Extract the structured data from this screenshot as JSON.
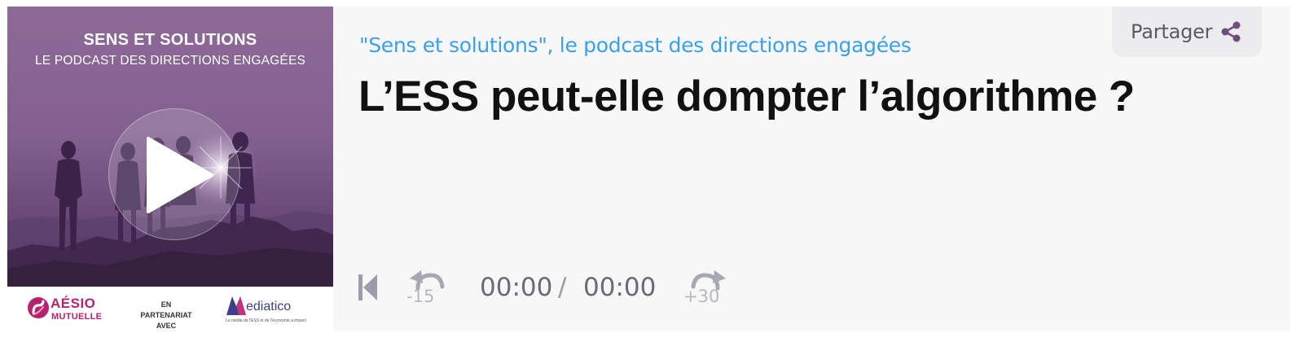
{
  "cover": {
    "title": "SENS ET SOLUTIONS",
    "subtitle": "LE PODCAST DES DIRECTIONS ENGAGÉES",
    "background_color": "#83608f",
    "footer": {
      "left_logo": {
        "name": "AÉSIO",
        "sub": "MUTUELLE",
        "color": "#b5236f"
      },
      "partner_text_line1": "EN PARTENARIAT",
      "partner_text_line2": "AVEC",
      "right_logo": {
        "name": "ediatico",
        "tagline": "Le média de l'ESS et de l'économie à impact",
        "color": "#3a3f8f"
      }
    }
  },
  "header": {
    "podcast_name": "\"Sens et solutions\", le podcast des directions engagées",
    "link_color": "#3aa0e8"
  },
  "episode": {
    "title": "L’ESS peut-elle dompter l’algorithme ?"
  },
  "share": {
    "label": "Partager",
    "icon": "share-icon"
  },
  "controls": {
    "skip_back_icon": "skip-back-icon",
    "rewind_label": "-15",
    "current_time": "00:00",
    "separator": "/",
    "total_time": "00:00",
    "forward_label": "+30",
    "play_icon": "play-icon"
  }
}
